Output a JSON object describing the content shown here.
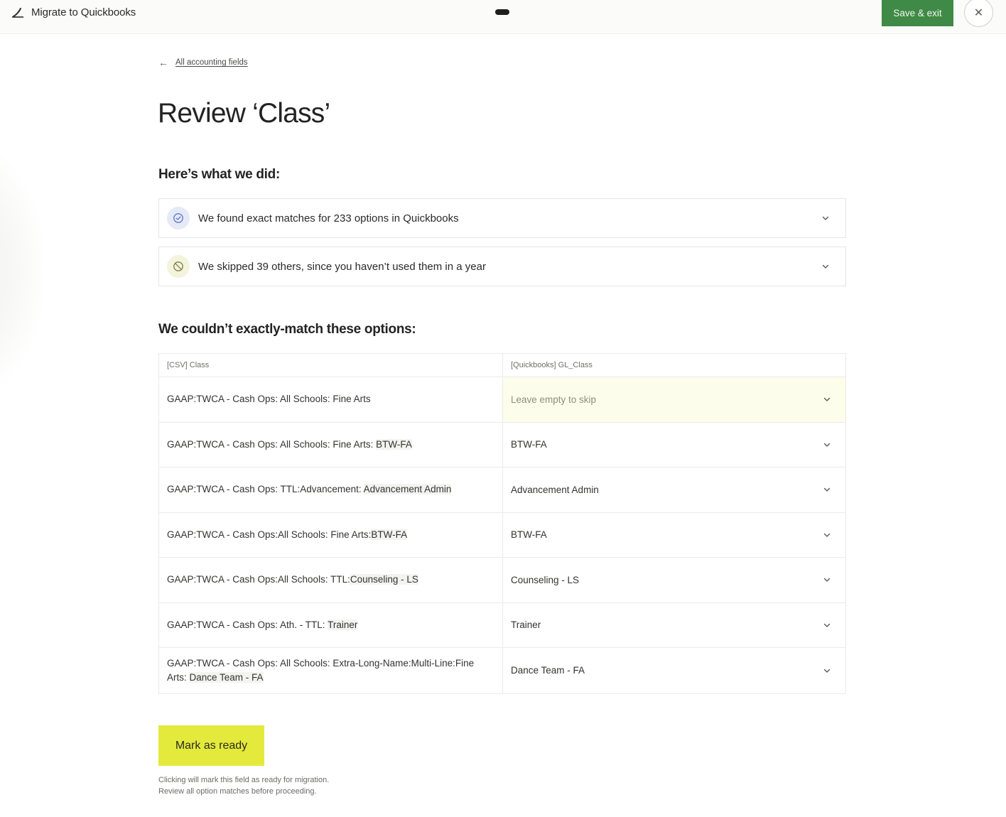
{
  "topbar": {
    "title": "Migrate to Quickbooks",
    "save_label": "Save & exit",
    "close_glyph": "✕",
    "app_icon": "wing-logo-icon",
    "brand_color": "#3f8a46"
  },
  "nav": {
    "back_arrow": "←",
    "back_label": "All accounting fields"
  },
  "page": {
    "title": "Review ‘Class’",
    "section_done": "Here’s what we did:",
    "section_unmatched": "We couldn’t exactly-match these options:"
  },
  "summaries": [
    {
      "text": "We found exact matches for 233 options in Quickbooks",
      "icon": "check-circle-icon"
    },
    {
      "text": "We skipped 39 others, since you haven’t used them in a year",
      "icon": "prohibited-icon"
    }
  ],
  "table": {
    "headers": [
      "[CSV] Class",
      "[Quickbooks] GL_Class"
    ],
    "rows": [
      {
        "source_prefix": "GAAP:TWCA - Cash Ops: All Schools: Fine Arts",
        "source_highlight": "",
        "target": "Leave empty to skip",
        "empty": true
      },
      {
        "source_prefix": "GAAP:TWCA - Cash Ops: All Schools: Fine Arts: ",
        "source_highlight": "BTW-FA",
        "target": "BTW-FA",
        "empty": false
      },
      {
        "source_prefix": "GAAP:TWCA - Cash Ops: TTL:Advancement: ",
        "source_highlight": "Advancement Admin",
        "target": "Advancement Admin",
        "empty": false
      },
      {
        "source_prefix": "GAAP:TWCA - Cash Ops:All Schools: Fine Arts:",
        "source_highlight": "BTW-FA",
        "target": "BTW-FA",
        "empty": false
      },
      {
        "source_prefix": "GAAP:TWCA - Cash Ops:All Schools: TTL:",
        "source_highlight": "Counseling - LS",
        "target": "Counseling - LS",
        "empty": false
      },
      {
        "source_prefix": "GAAP:TWCA - Cash Ops: Ath. - TTL: ",
        "source_highlight": "Trainer",
        "target": "Trainer",
        "empty": false
      },
      {
        "source_prefix": "GAAP:TWCA - Cash Ops: All Schools: Extra-Long-Name:Multi-Line:Fine Arts: ",
        "source_highlight": "Dance Team - FA",
        "target": "Dance Team - FA",
        "empty": false
      }
    ]
  },
  "actions": {
    "ready_label": "Mark as ready",
    "ready_color": "#e4ea3c",
    "helper_line1": "Clicking will mark this field as ready for migration.",
    "helper_line2": "Review all option matches before proceeding."
  }
}
